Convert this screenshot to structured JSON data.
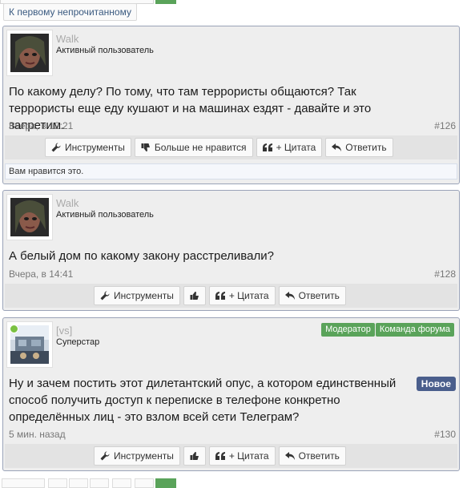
{
  "nav": {
    "first_unread_label": "К первому непрочитанному"
  },
  "buttons": {
    "tools": "Инструменты",
    "unlike": "Больше не нравится",
    "quote": "+ Цитата",
    "reply": "Ответить"
  },
  "posts": [
    {
      "username": "Walk",
      "user_title": "Активный пользователь",
      "text": "По какому делу? По тому, что там террористы общаются? Так террористы еще еду кушают и на машинах ездят - давайте и это запретим.",
      "date": "Вчера, в 12:21",
      "number": "#126",
      "likes_text": "Вам нравится это."
    },
    {
      "username": "Walk",
      "user_title": "Активный пользователь",
      "text": "А белый дом по какому закону расстреливали?",
      "date": "Вчера, в 14:41",
      "number": "#128"
    },
    {
      "username": "[vs]",
      "user_title": "Суперстар",
      "badges": [
        "Модератор",
        "Команда форума"
      ],
      "new_label": "Новое",
      "text": "Ну и зачем постить этот дилетантский опус, а котором единственный способ получить доступ к переписке в телефоне конкретно определённых лиц - это взлом всей сети Телеграм?",
      "date": "5 мин. назад",
      "number": "#130"
    }
  ],
  "colors": {
    "post_border": "#9aa3b8",
    "post_bg": "#eeeeee",
    "badge_green": "#5aa35a",
    "new_badge": "#4a5e8c",
    "online": "#7ac142"
  },
  "icons": [
    "wrench-icon",
    "thumbs-down-icon",
    "thumbs-up-icon",
    "quote-icon",
    "reply-arrow-icon",
    "avatar-image"
  ]
}
